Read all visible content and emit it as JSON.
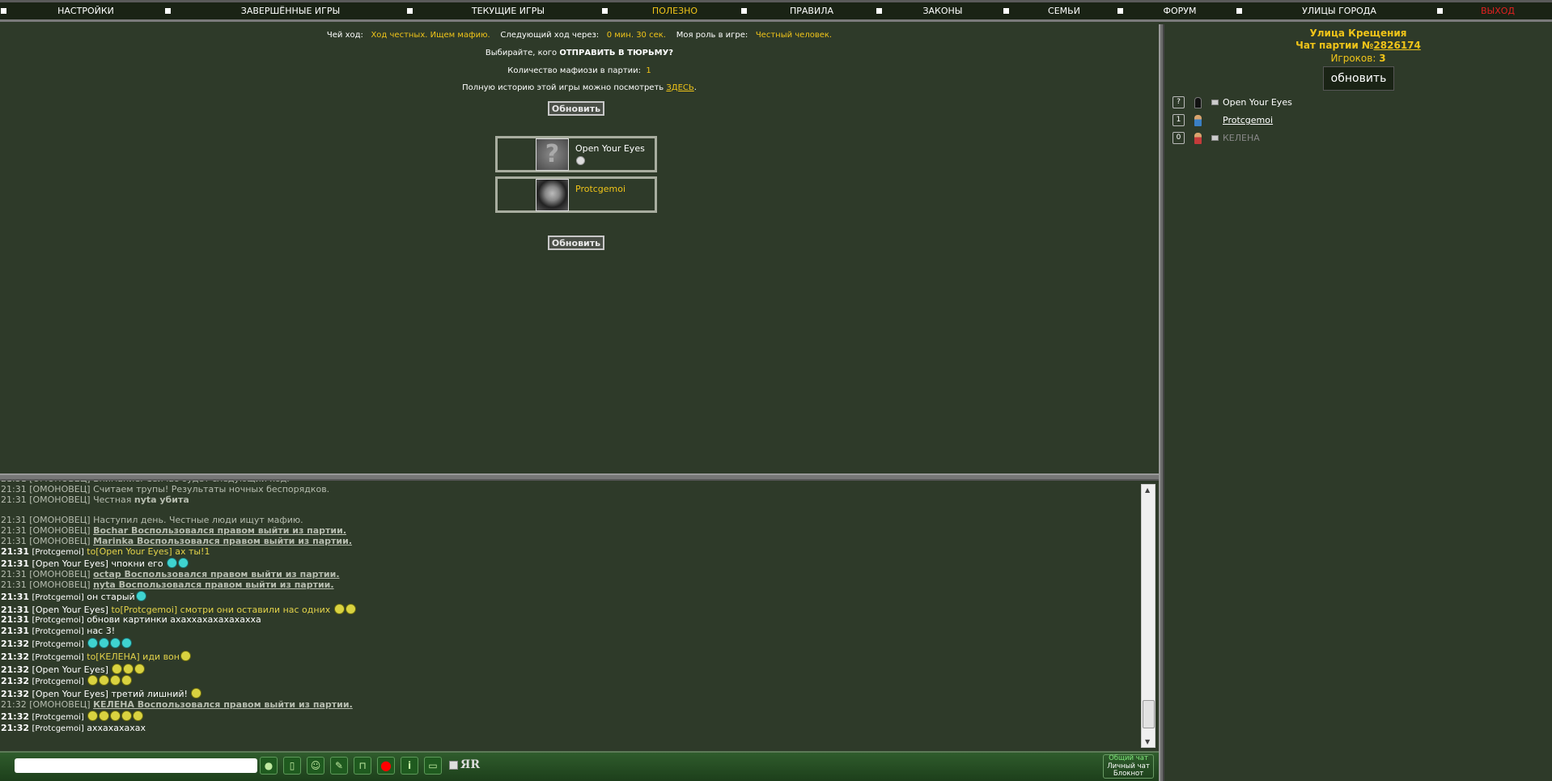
{
  "nav": [
    "НАСТРОЙКИ",
    "ЗАВЕРШЁННЫЕ ИГРЫ",
    "ТЕКУЩИЕ ИГРЫ",
    "ПОЛЕЗНО",
    "ПРАВИЛА",
    "ЗАКОНЫ",
    "СЕМЬИ",
    "ФОРУМ",
    "УЛИЦЫ ГОРОДА",
    "ВЫХОД"
  ],
  "colors": {
    "accent": "#f0c419",
    "exit": "#e02020",
    "bg": "#2e3a29"
  },
  "game": {
    "turn_label": "Чей ход:",
    "turn_value": "Ход честных. Ищем мафию.",
    "next_label": "Следующий ход через:",
    "next_value": "0 мин. 30 сек.",
    "role_label": "Моя роль в игре:",
    "role_value": "Честный человек.",
    "choose_prefix": "Выбирайте, кого ",
    "choose_bold": "ОТПРАВИТЬ В ТЮРЬМУ?",
    "mafia_label": "Количество мафиози в партии:",
    "mafia_count": "1",
    "history_text": "Полную историю этой игры можно посмотреть ",
    "history_link": "ЗДЕСЬ",
    "history_end": ".",
    "refresh": "Обновить",
    "cards": [
      {
        "name": "Open Your Eyes"
      },
      {
        "name": "Protcgemoi"
      }
    ]
  },
  "right": {
    "street": "Улица Крещения",
    "chat_prefix": "Чат партии №",
    "chat_no": "2826174",
    "players_label": "Игроков: ",
    "players_count": "3",
    "refresh": "обновить",
    "players": [
      {
        "num": "?",
        "name": "Open Your Eyes"
      },
      {
        "num": "1",
        "name": "Protcgemoi"
      },
      {
        "num": "0",
        "name": "КЕЛЕНА"
      }
    ]
  },
  "chat": [
    {
      "time": "21:31",
      "sys": true,
      "text": "Внимание. Сейчас будет следующий ход."
    },
    {
      "time": "21:31",
      "sys": true,
      "text": "Считаем трупы! Результаты ночных беспорядков."
    },
    {
      "time": "21:31",
      "sys": true,
      "text": "Честная ",
      "bold": "nyta убита"
    },
    {
      "blank": true
    },
    {
      "time": "21:31",
      "sys": true,
      "text": "Наступил день. Честные люди ищут мафию."
    },
    {
      "time": "21:31",
      "sys": true,
      "u": "Bochar Воспользовался правом выйти из партии."
    },
    {
      "time": "21:31",
      "sys": true,
      "u": "Marinka Воспользовался правом выйти из партии."
    },
    {
      "time": "21:31",
      "author": "Protcgemoi",
      "to": "Open Your Eyes",
      "text": "ах ты!1"
    },
    {
      "time": "21:31",
      "author": "Open Your Eyes",
      "text": "чпокни его ",
      "smiles": "cc"
    },
    {
      "time": "21:31",
      "sys": true,
      "u": "octap Воспользовался правом выйти из партии."
    },
    {
      "time": "21:31",
      "sys": true,
      "u": "nyta Воспользовался правом выйти из партии."
    },
    {
      "time": "21:31",
      "author": "Protcgemoi",
      "text": "он старый",
      "smiles": "c"
    },
    {
      "time": "21:31",
      "author": "Open Your Eyes",
      "to": "Protcgemoi",
      "text": "смотри они оставили нас одних ",
      "smiles": "gg"
    },
    {
      "time": "21:31",
      "author": "Protcgemoi",
      "text": "обнови картинки ахаххахахахахахха"
    },
    {
      "time": "21:31",
      "author": "Protcgemoi",
      "text": "нас 3!"
    },
    {
      "time": "21:32",
      "author": "Protcgemoi",
      "text": "",
      "smiles": "cccc"
    },
    {
      "time": "21:32",
      "author": "Protcgemoi",
      "to": "КЕЛЕНА",
      "text": "иди вон",
      "smiles": "g"
    },
    {
      "time": "21:32",
      "author": "Open Your Eyes",
      "text": "",
      "smiles": "ggg"
    },
    {
      "time": "21:32",
      "author": "Protcgemoi",
      "text": "",
      "smiles": "gggg"
    },
    {
      "time": "21:32",
      "author": "Open Your Eyes",
      "text": "третий лишний! ",
      "smiles": "g"
    },
    {
      "time": "21:32",
      "sys": true,
      "u": "КЕЛЕНА Воспользовался правом выйти из партии."
    },
    {
      "time": "21:32",
      "author": "Protcgemoi",
      "text": "",
      "smiles": "ggggg"
    },
    {
      "time": "21:32",
      "author": "Protcgemoi",
      "text": "аххахахахах"
    }
  ],
  "toolbar": {
    "translit": "ЯR",
    "tabs": [
      "Общий чат",
      "Личный чат",
      "Блокнот"
    ],
    "icons": [
      "speech-bubble-icon",
      "phone-icon",
      "smiley-icon",
      "eraser-icon",
      "lock-icon",
      "red-dot-icon",
      "info-icon",
      "screen-icon"
    ]
  }
}
